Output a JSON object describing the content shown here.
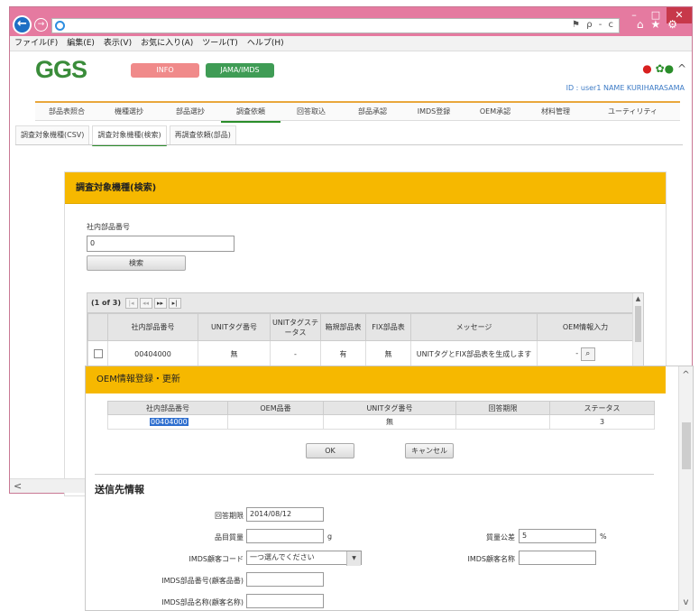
{
  "browser": {
    "window_controls": {
      "minimize": "–",
      "maximize": "□",
      "close": "✕"
    },
    "address_tools": "ρ - c",
    "menu": [
      "ファイル(F)",
      "編集(E)",
      "表示(V)",
      "お気に入り(A)",
      "ツール(T)",
      "ヘルプ(H)"
    ]
  },
  "app": {
    "logo": "GGS",
    "pill_info": "INFO",
    "pill_jama": "JAMA/IMDS",
    "user_id": "ID : user1 NAME KURIHARASAMA",
    "nav": [
      "部品表照合",
      "機種選抄",
      "部品選抄",
      "調査依頼",
      "回答取込",
      "部品承認",
      "IMDS登録",
      "OEM承認",
      "材料管理",
      "ユーティリティ"
    ],
    "subtabs": [
      "調査対象機種(CSV)",
      "調査対象機種(検索)",
      "再調査依頼(部品)"
    ]
  },
  "panel": {
    "title": "調査対象機種(検索)",
    "field_label": "社内部品番号",
    "field_value": "0",
    "search_button": "検索",
    "pager_text": "(1 of 3)",
    "pager_buttons": [
      "|◂",
      "◂◂",
      "▸▸",
      "▸|"
    ],
    "columns": [
      "",
      "社内部品番号",
      "UNITタグ番号",
      "UNITタグステータス",
      "箱規部品表",
      "FIX部品表",
      "メッセージ",
      "OEM情報入力"
    ],
    "rows": [
      {
        "part_no": "00404000",
        "unit_tag": "無",
        "unit_status": "-",
        "box": "有",
        "fix": "無",
        "message": "UNITタグとFIX部品表を生成します",
        "oem": "-"
      }
    ]
  },
  "dialog": {
    "title": "OEM情報登録・更新",
    "columns": [
      "社内部品番号",
      "OEM品番",
      "UNITタグ番号",
      "回答期限",
      "ステータス"
    ],
    "row": {
      "part_no": "00404000",
      "oem_no": "",
      "unit_tag": "無",
      "deadline": "",
      "status": "3"
    },
    "ok_button": "OK",
    "cancel_button": "キャンセル",
    "section_title": "送信先情報",
    "answer_deadline_label": "回答期限",
    "answer_deadline_value": "2014/08/12",
    "item_weight_label": "品目質量",
    "item_weight_unit": "g",
    "mass_tolerance_label": "質量公差",
    "mass_tolerance_value": "5",
    "mass_tolerance_unit": "%",
    "imds_customer_code_label": "IMDS顧客コード",
    "imds_customer_code_value": "一つ選んでください",
    "imds_customer_name_label": "IMDS顧客名称",
    "imds_part_no_label": "IMDS部品番号(顧客品番)",
    "imds_part_name_label": "IMDS部品名称(顧客名称)"
  },
  "colors": {
    "titlebar": "#e57aa0",
    "accent_yellow": "#f6b800",
    "brand_green": "#3a8c3a",
    "info_pink": "#f08a8a"
  }
}
